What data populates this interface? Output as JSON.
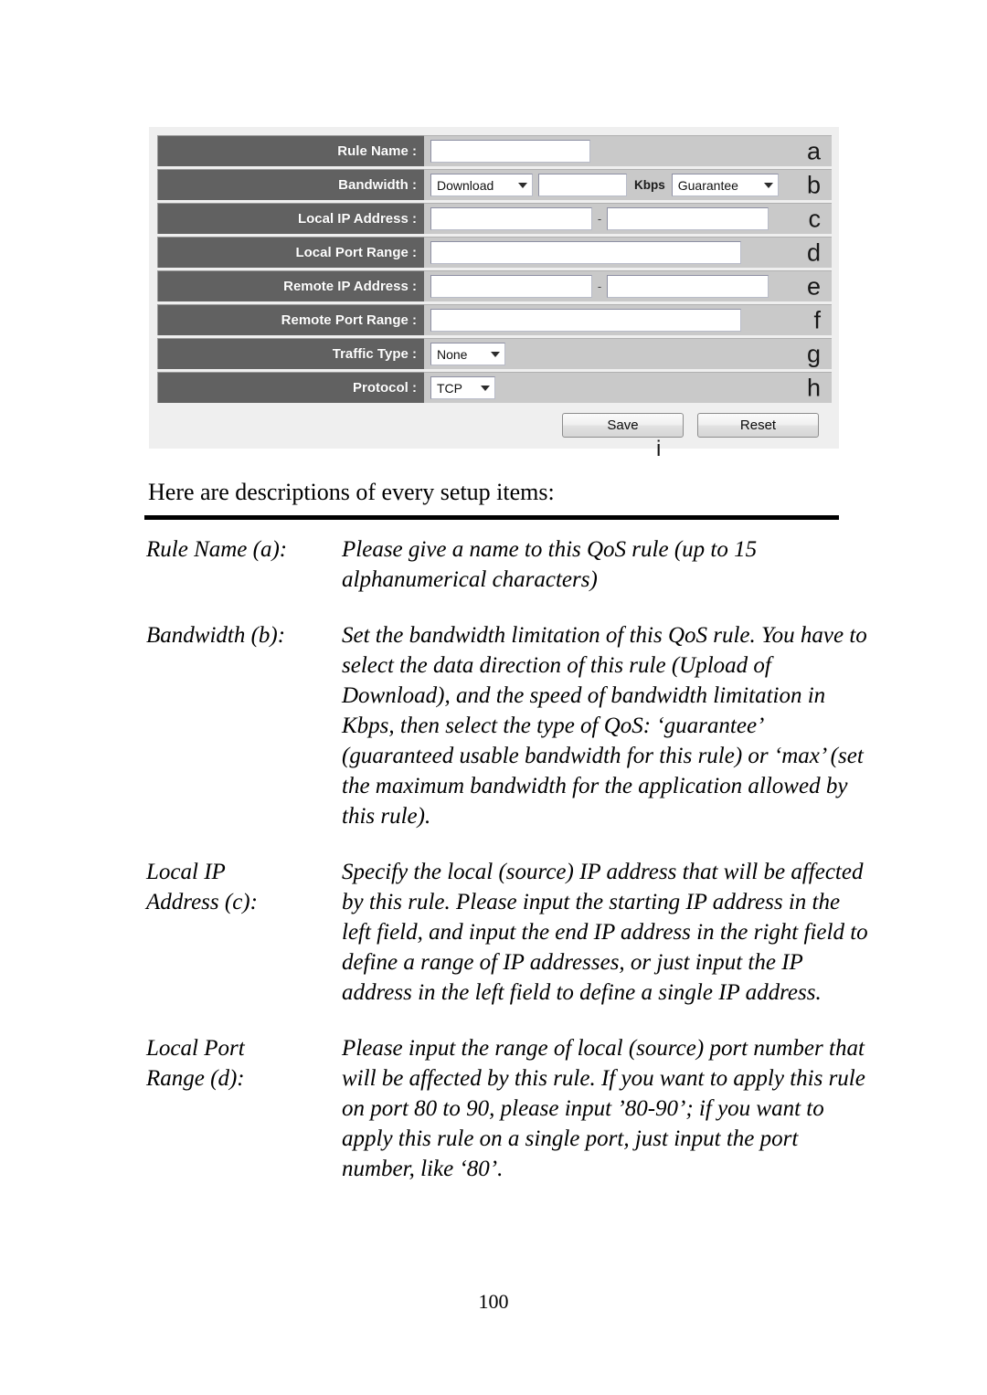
{
  "form": {
    "rows": [
      {
        "label": "Rule Name :",
        "letter": "a",
        "kind": "text",
        "value": ""
      },
      {
        "label": "Bandwidth :",
        "letter": "b",
        "kind": "bandwidth",
        "direction": "Download",
        "speed": "",
        "unit": "Kbps",
        "qos_type": "Guarantee"
      },
      {
        "label": "Local IP Address :",
        "letter": "c",
        "kind": "range",
        "start": "",
        "separator": "-",
        "end": ""
      },
      {
        "label": "Local Port Range :",
        "letter": "d",
        "kind": "text",
        "value": ""
      },
      {
        "label": "Remote IP Address :",
        "letter": "e",
        "kind": "range",
        "start": "",
        "separator": "-",
        "end": ""
      },
      {
        "label": "Remote Port Range :",
        "letter": "f",
        "kind": "text",
        "value": ""
      },
      {
        "label": "Traffic Type :",
        "letter": "g",
        "kind": "select",
        "value": "None"
      },
      {
        "label": "Protocol :",
        "letter": "h",
        "kind": "select",
        "value": "TCP"
      }
    ],
    "buttons": {
      "save": "Save",
      "reset": "Reset",
      "letter": "i"
    },
    "colors": {
      "label_bg": "#616161",
      "value_bg": "#c9c9c9",
      "panel_bg": "#efefef",
      "label_text": "#ffffff"
    }
  },
  "document": {
    "intro": "Here are descriptions of every setup items:",
    "page_number": "100",
    "definitions": [
      {
        "term_line1": "Rule Name (a):",
        "term_line2": "",
        "description": "Please give a name to this QoS rule (up to 15 alphanumerical characters)"
      },
      {
        "term_line1": "Bandwidth (b):",
        "term_line2": "",
        "description": "Set the bandwidth limitation of this QoS rule. You have to select the data direction of this rule (Upload of Download), and the speed of bandwidth limitation in Kbps, then select the type of QoS: ‘guarantee’ (guaranteed usable bandwidth for this rule) or ‘max’ (set the maximum bandwidth for the application allowed by this rule)."
      },
      {
        "term_line1": "Local IP",
        "term_line2": "Address (c):",
        "description": "Specify the local (source) IP address that will be affected by this rule. Please input the starting IP address in the left field, and input the end IP address in the right field to define a range of IP addresses, or just input the IP address in the left field to define a single IP address."
      },
      {
        "term_line1": "Local Port",
        "term_line2": "Range (d):",
        "description": "Please input the range of local (source) port number that will be affected by this rule. If you want to apply this rule on port 80 to 90, please input ’80-90’; if you want to apply this rule on a single port, just input the port number, like ‘80’."
      }
    ]
  }
}
